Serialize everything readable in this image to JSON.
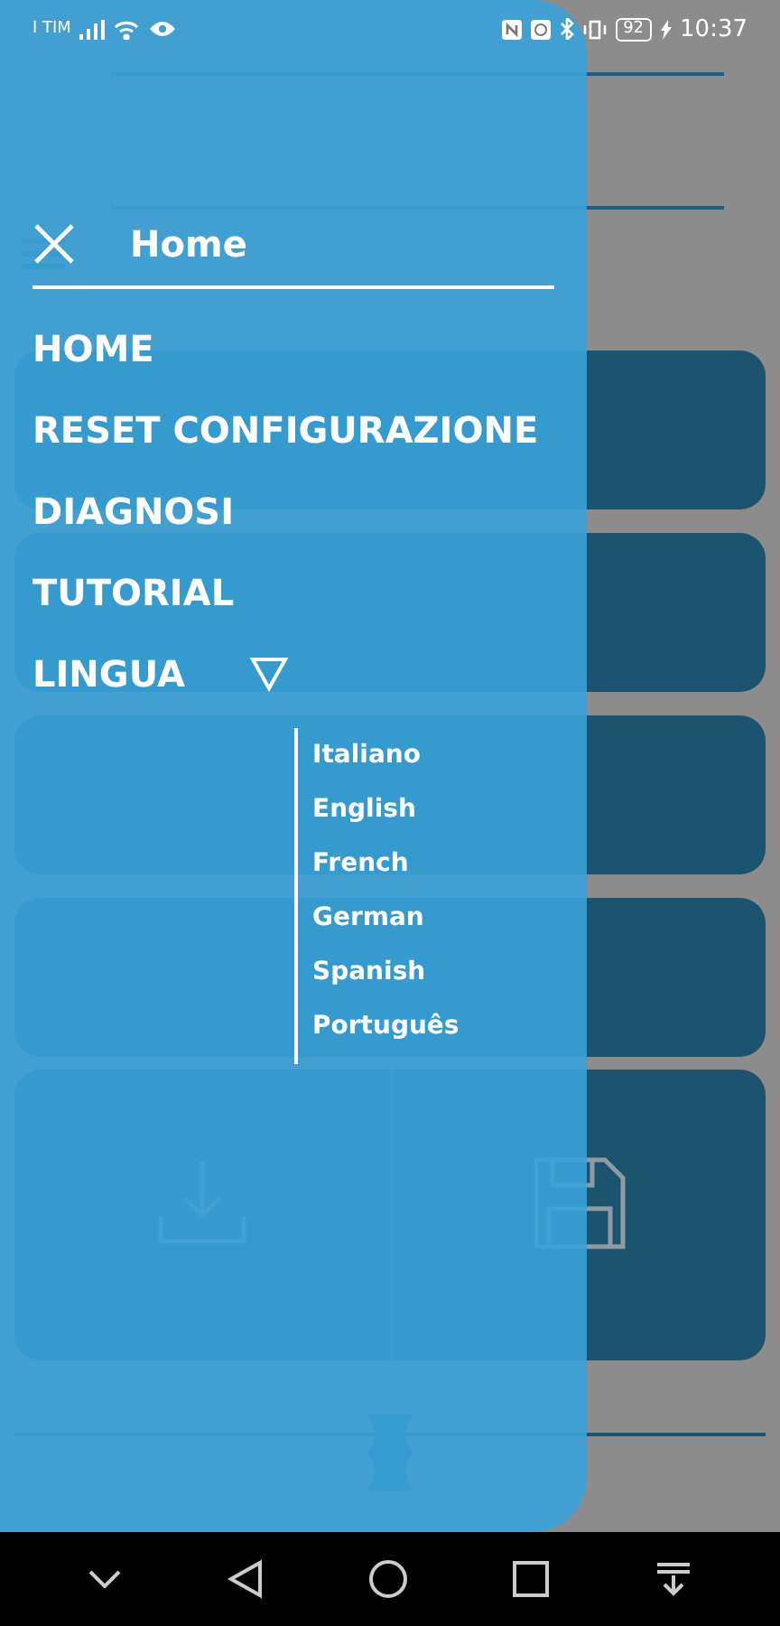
{
  "status_bar": {
    "carrier": "I TIM",
    "battery": "92",
    "time": "10:37"
  },
  "app": {
    "actions": [
      {
        "kind": "download"
      },
      {
        "kind": "save"
      }
    ]
  },
  "drawer": {
    "title": "Home",
    "menu": [
      {
        "label": "HOME",
        "kind": "link"
      },
      {
        "label": "RESET CONFIGURAZIONE",
        "kind": "link"
      },
      {
        "label": "DIAGNOSI",
        "kind": "link"
      },
      {
        "label": "TUTORIAL",
        "kind": "link"
      },
      {
        "label": "LINGUA",
        "kind": "dropdown",
        "expanded": true
      }
    ],
    "languages": [
      {
        "label": "Italiano"
      },
      {
        "label": "English"
      },
      {
        "label": "French"
      },
      {
        "label": "German"
      },
      {
        "label": "Spanish"
      },
      {
        "label": "Português"
      }
    ]
  }
}
